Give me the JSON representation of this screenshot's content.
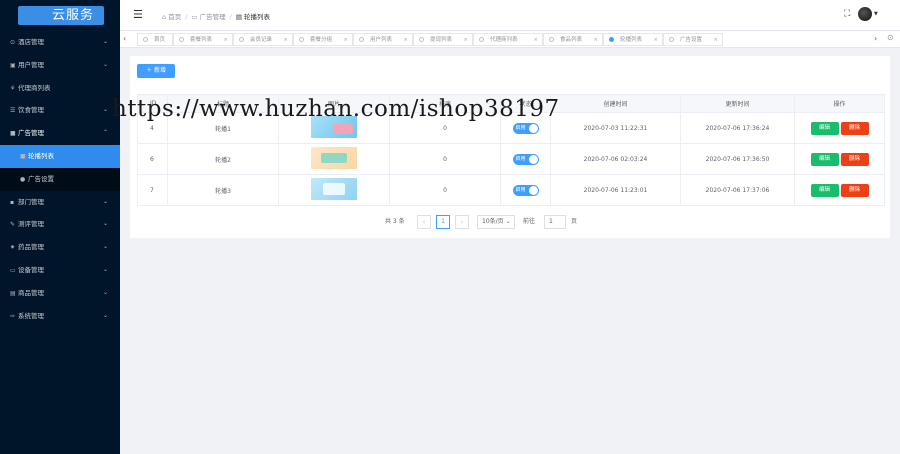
{
  "app": {
    "logo_text": "云服务"
  },
  "sidebar": {
    "items": [
      {
        "label": "酒店管理",
        "icon": "bookmark-icon",
        "glyph": "⊙",
        "expanded": false
      },
      {
        "label": "用户管理",
        "icon": "user-icon",
        "glyph": "▣",
        "expanded": false
      },
      {
        "label": "代理商列表",
        "icon": "agent-icon",
        "glyph": "⚘",
        "expanded": false
      },
      {
        "label": "饮食管理",
        "icon": "food-icon",
        "glyph": "☰",
        "expanded": false
      },
      {
        "label": "广告管理",
        "icon": "ad-icon",
        "glyph": "■",
        "expanded": true,
        "children": [
          {
            "label": "轮播列表",
            "icon": "square-icon",
            "glyph": "■",
            "active": true
          },
          {
            "label": "广告设置",
            "icon": "dot-icon",
            "glyph": "●",
            "active": false
          }
        ]
      },
      {
        "label": "部门管理",
        "icon": "department-icon",
        "glyph": "▪",
        "expanded": false
      },
      {
        "label": "测评管理",
        "icon": "pen-icon",
        "glyph": "✎",
        "expanded": false
      },
      {
        "label": "药品管理",
        "icon": "gear-icon",
        "glyph": "✷",
        "expanded": false
      },
      {
        "label": "设备管理",
        "icon": "monitor-icon",
        "glyph": "▭",
        "expanded": false
      },
      {
        "label": "商品管理",
        "icon": "box-icon",
        "glyph": "▤",
        "expanded": false
      },
      {
        "label": "系统管理",
        "icon": "wrench-icon",
        "glyph": "✑",
        "expanded": false
      }
    ]
  },
  "header": {
    "breadcrumb": [
      {
        "label": "首页",
        "icon": "home-icon",
        "glyph": "⌂"
      },
      {
        "label": "广告管理",
        "icon": "folder-icon",
        "glyph": "▭"
      },
      {
        "label": "轮播列表",
        "icon": "image-icon",
        "glyph": "▤"
      }
    ]
  },
  "tabs": [
    {
      "label": "首页",
      "active": false
    },
    {
      "label": "套餐列表",
      "active": false
    },
    {
      "label": "会员记录",
      "active": false
    },
    {
      "label": "套餐分组",
      "active": false
    },
    {
      "label": "用户列表",
      "active": false
    },
    {
      "label": "提现列表",
      "active": false
    },
    {
      "label": "代理商列表",
      "active": false
    },
    {
      "label": "食品列表",
      "active": false
    },
    {
      "label": "轮播列表",
      "active": true
    },
    {
      "label": "广告设置",
      "active": false
    }
  ],
  "toolbar": {
    "add_label": "新增"
  },
  "table": {
    "columns": [
      "ID",
      "标题",
      "图片",
      "排序",
      "状态",
      "创建时间",
      "更新时间",
      "操作"
    ],
    "rows": [
      {
        "id": "4",
        "title": "轮播1",
        "sort": "0",
        "status": "启用",
        "created": "2020-07-03 11:22:31",
        "updated": "2020-07-06 17:36:24",
        "edit": "编辑",
        "delete": "删除"
      },
      {
        "id": "6",
        "title": "轮播2",
        "sort": "0",
        "status": "启用",
        "created": "2020-07-06 02:03:24",
        "updated": "2020-07-06 17:36:50",
        "edit": "编辑",
        "delete": "删除"
      },
      {
        "id": "7",
        "title": "轮播3",
        "sort": "0",
        "status": "启用",
        "created": "2020-07-06 11:23:01",
        "updated": "2020-07-06 17:37:06",
        "edit": "编辑",
        "delete": "删除"
      }
    ]
  },
  "pagination": {
    "total_text": "共 3 条",
    "current_page": "1",
    "page_size_text": "10条/页",
    "goto_label": "前往",
    "goto_value": "1",
    "page_unit": "页"
  },
  "watermark": "https://www.huzhan.com/ishop38197",
  "colors": {
    "sidebar_bg": "#001529",
    "primary": "#409eff",
    "success": "#19be6b",
    "danger": "#ed4014"
  }
}
